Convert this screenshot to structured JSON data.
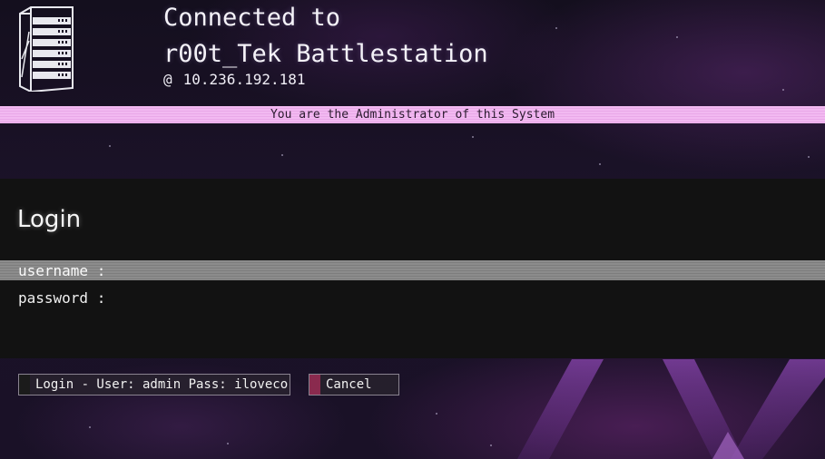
{
  "header": {
    "title_line1": "Connected to",
    "title_line2": "r00t_Tek Battlestation",
    "at_symbol": "@",
    "ip_address": "10.236.192.181",
    "icon": "server-rack-icon"
  },
  "banner": {
    "text": "You are the Administrator of this System"
  },
  "login": {
    "title": "Login",
    "username_label": "username :",
    "username_value": "",
    "password_label": "password :",
    "password_value": ""
  },
  "buttons": {
    "login_label": "Login - User: admin Pass: ilovecorm",
    "cancel_label": "Cancel"
  },
  "colors": {
    "banner_bg": "#f2b9f1",
    "panel_bg": "#121212",
    "username_row_bg": "#8c8c8c",
    "cancel_accent": "#8a2a4e",
    "deco_purple": "#7a3a9a"
  }
}
